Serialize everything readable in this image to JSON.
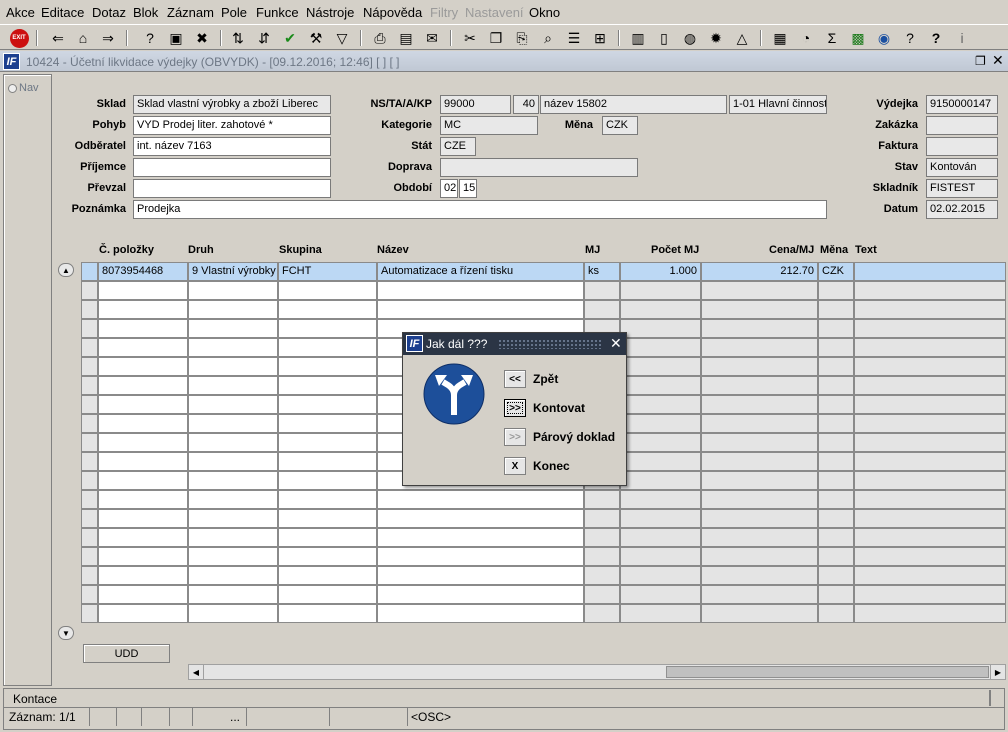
{
  "menu": [
    "Akce",
    "Editace",
    "Dotaz",
    "Blok",
    "Záznam",
    "Pole",
    "Funkce",
    "Nástroje",
    "Nápověda",
    "Filtry",
    "Nastavení",
    "Okno"
  ],
  "window_title": "10424 - Účetní likvidace výdejky (OBVYDK) - [09.12.2016; 12:46]  [ ]  [ ]",
  "nav_label": "Nav",
  "form": {
    "sklad_label": "Sklad",
    "sklad": "Sklad vlastní výrobky a zboží Liberec",
    "pohyb_label": "Pohyb",
    "pohyb": "VYD Prodej liter. zahotové *",
    "odberatel_label": "Odběratel",
    "odberatel": "int. název 7163",
    "prijemce_label": "Příjemce",
    "prijemce": "",
    "prevzal_label": "Převzal",
    "prevzal": "",
    "poznamka_label": "Poznámka",
    "poznamka": "Prodejka",
    "nstaak_label": "NS/TA/A/KP",
    "ns": "99000",
    "ta": "40",
    "a": "název 15802",
    "kp": "1-01 Hlavní činnost",
    "kategorie_label": "Kategorie",
    "kategorie": "MC",
    "mena_label": "Měna",
    "mena": "CZK",
    "stat_label": "Stát",
    "stat": "CZE",
    "doprava_label": "Doprava",
    "doprava": "",
    "obdobi_label": "Období",
    "obdobi_m": "02",
    "obdobi_y": "15",
    "vydejka_label": "Výdejka",
    "vydejka": "9150000147",
    "zakazka_label": "Zakázka",
    "zakazka": "",
    "faktura_label": "Faktura",
    "faktura": "",
    "stav_label": "Stav",
    "stav": "Kontován",
    "skladnik_label": "Skladník",
    "skladnik": "FISTEST",
    "datum_label": "Datum",
    "datum": "02.02.2015"
  },
  "grid": {
    "headers": {
      "polozka": "Č. položky",
      "druh": "Druh",
      "skupina": "Skupina",
      "nazev": "Název",
      "mj": "MJ",
      "pocet": "Počet MJ",
      "cena": "Cena/MJ",
      "mena": "Měna",
      "text": "Text"
    },
    "row": {
      "polozka": "8073954468",
      "druh": "9 Vlastní výrobky",
      "skupina": "FCHT",
      "nazev": "Automatizace a řízení tisku",
      "mj": "ks",
      "pocet": "1.000",
      "cena": "212.70",
      "mena": "CZK",
      "text": ""
    },
    "udd_label": "UDD"
  },
  "dialog": {
    "title": "Jak dál ???",
    "buttons": [
      {
        "glyph": "<<",
        "label": "Zpět"
      },
      {
        "glyph": ">>",
        "label": "Kontovat"
      },
      {
        "glyph": ">>",
        "label": "Párový doklad"
      },
      {
        "glyph": "X",
        "label": "Konec"
      }
    ]
  },
  "status": {
    "line1": "Kontace",
    "record": "Záznam: 1/1",
    "dots": "...",
    "osc": "<OSC>"
  },
  "colors": {
    "selected_row": "#bcd8f4",
    "title_bar": "#2b3545",
    "logo": "#1c3f8f",
    "sign": "#1d4f9a"
  }
}
